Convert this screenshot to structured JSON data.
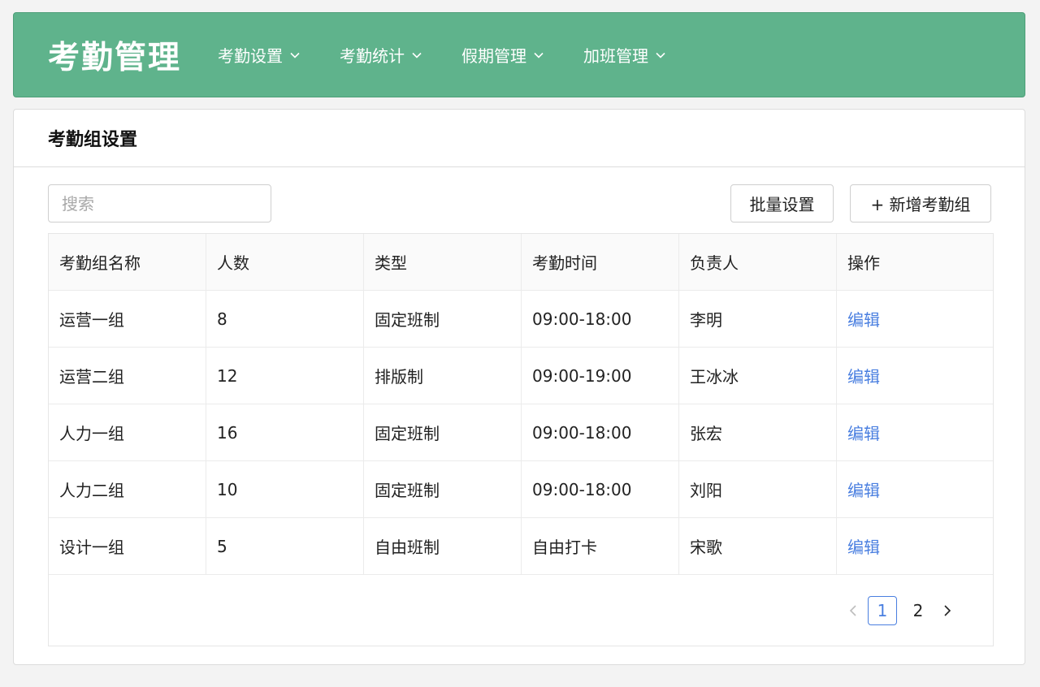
{
  "app": {
    "title": "考勤管理"
  },
  "nav": [
    {
      "label": "考勤设置"
    },
    {
      "label": "考勤统计"
    },
    {
      "label": "假期管理"
    },
    {
      "label": "加班管理"
    }
  ],
  "panel": {
    "title": "考勤组设置"
  },
  "toolbar": {
    "search_placeholder": "搜索",
    "search_value": "",
    "batch_label": "批量设置",
    "add_label": "+ 新增考勤组"
  },
  "table": {
    "headers": [
      "考勤组名称",
      "人数",
      "类型",
      "考勤时间",
      "负责人",
      "操作"
    ],
    "rows": [
      {
        "name": "运营一组",
        "count": "8",
        "type": "固定班制",
        "time": "09:00-18:00",
        "owner": "李明",
        "action": "编辑"
      },
      {
        "name": "运营二组",
        "count": "12",
        "type": "排版制",
        "time": "09:00-19:00",
        "owner": "王冰冰",
        "action": "编辑"
      },
      {
        "name": "人力一组",
        "count": "16",
        "type": "固定班制",
        "time": "09:00-18:00",
        "owner": "张宏",
        "action": "编辑"
      },
      {
        "name": "人力二组",
        "count": "10",
        "type": "固定班制",
        "time": "09:00-18:00",
        "owner": "刘阳",
        "action": "编辑"
      },
      {
        "name": "设计一组",
        "count": "5",
        "type": "自由班制",
        "time": "自由打卡",
        "owner": "宋歌",
        "action": "编辑"
      }
    ]
  },
  "pagination": {
    "pages": [
      "1",
      "2"
    ],
    "current": "1"
  },
  "colors": {
    "header_bg": "#5fb38c",
    "link": "#4a7fe0"
  }
}
